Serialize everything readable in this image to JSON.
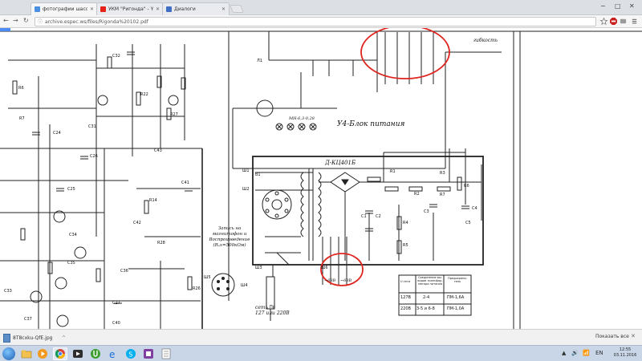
{
  "browser": {
    "tabs": [
      {
        "title": "фотографии шасси ри…",
        "favicon_color": "#4a8fe0"
      },
      {
        "title": "УКМ \"Ригонда\" - YouTu…",
        "favicon_color": "#e62117"
      },
      {
        "title": "Диалоги",
        "favicon_color": "#3f6fc4"
      }
    ],
    "active_tab": 0,
    "window_controls": [
      "−",
      "□",
      "✕"
    ],
    "address": "archive.espec.ws/files/Rigonda%20102.pdf",
    "toolbar_icons": [
      "star-icon",
      "abp-icon",
      "extensions-icon",
      "menu-icon"
    ]
  },
  "schematic": {
    "block_title": "У4-Блок питания",
    "rectifier_label": "Д-КЦ401Б",
    "labels_left": [
      "R6",
      "R7",
      "C26",
      "C24",
      "C25",
      "C27",
      "R22",
      "R27",
      "R28",
      "С31",
      "С32",
      "С33",
      "С34",
      "С35",
      "С36",
      "С37",
      "С40",
      "С41",
      "С42",
      "С43",
      "R14",
      "R26"
    ],
    "labels_right": [
      "Л1",
      "В1",
      "Пр",
      "R1",
      "R2",
      "R3",
      "R4",
      "R5",
      "R6",
      "R7",
      "С1",
      "С2",
      "С3",
      "С4",
      "С5",
      "Ш1",
      "Ш2",
      "Ш3",
      "Ш4",
      "Ш5",
      "Ш6"
    ],
    "record_note": "Запись на\nмагнитофон и\nВоспроизведение\n(Rₑх=500кОм)",
    "mains_label": "сеть\n127 или 220В",
    "voltage_left": "~63В",
    "voltage_right": "~63В",
    "lamp_label": "МН-6,3-0,28",
    "table": {
      "headers": [
        "U сети",
        "Соединение вы-\nводов трансфор-\nматора питания",
        "Предохрани-\nтель"
      ],
      "rows": [
        [
          "127В",
          "2-4",
          "ПМ-1,6А"
        ],
        [
          "220В",
          "3-5 и 6-8",
          "ПМ-1,0А"
        ]
      ]
    },
    "top_right_label": "гибкость",
    "annotation_color": "#e0241f"
  },
  "downloads": {
    "item": "8T8cxku-QfE.jpg",
    "show_all": "Показать все",
    "close": "✕"
  },
  "taskbar": {
    "time": "12:55",
    "date": "03.11.2016",
    "tray": [
      "▲",
      "🔊",
      "📶",
      "EN"
    ]
  }
}
